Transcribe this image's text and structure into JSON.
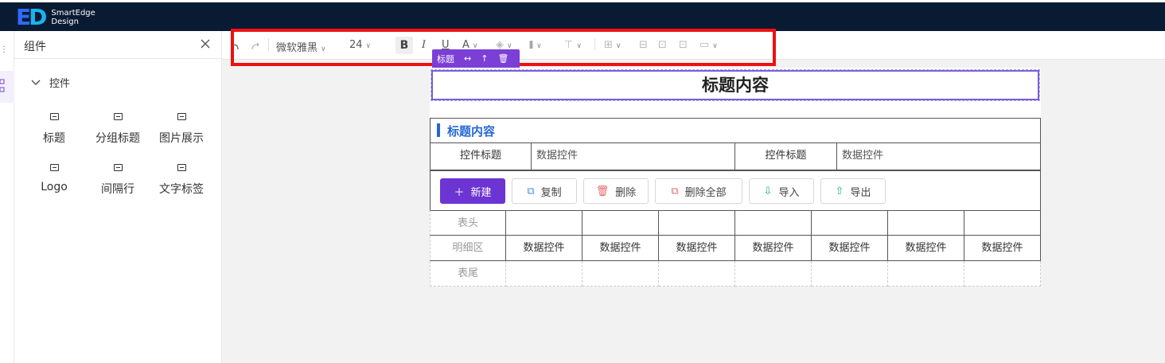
{
  "brand": {
    "name": "SmartEdge",
    "sub": "Design"
  },
  "panel": {
    "title": "组件",
    "group": "控件",
    "widgets": [
      "标题",
      "分组标题",
      "图片展示",
      "Logo",
      "间隔行",
      "文字标签"
    ]
  },
  "toolbar": {
    "font": "微软雅黑",
    "size": "24",
    "bold": "B",
    "italic": "I",
    "underline": "U",
    "color": "A"
  },
  "selection": {
    "tag": "标题"
  },
  "canvas": {
    "title": "标题内容",
    "section_title": "标题内容",
    "fields": {
      "label1": "控件标题",
      "value1": "数据控件",
      "label2": "控件标题",
      "value2": "数据控件"
    },
    "buttons": {
      "new": "新建",
      "copy": "复制",
      "delete": "删除",
      "delete_all": "删除全部",
      "import": "导入",
      "export": "导出"
    },
    "grid": {
      "header": "表头",
      "detail": "明细区",
      "footer": "表尾",
      "cells": [
        "数据控件",
        "数据控件",
        "数据控件",
        "数据控件",
        "数据控件",
        "数据控件",
        "数据控件"
      ]
    }
  },
  "colors": {
    "accent": "#6c34d2",
    "topbar": "#091a33",
    "highlight": "#ee1111",
    "section": "#2567d6"
  }
}
